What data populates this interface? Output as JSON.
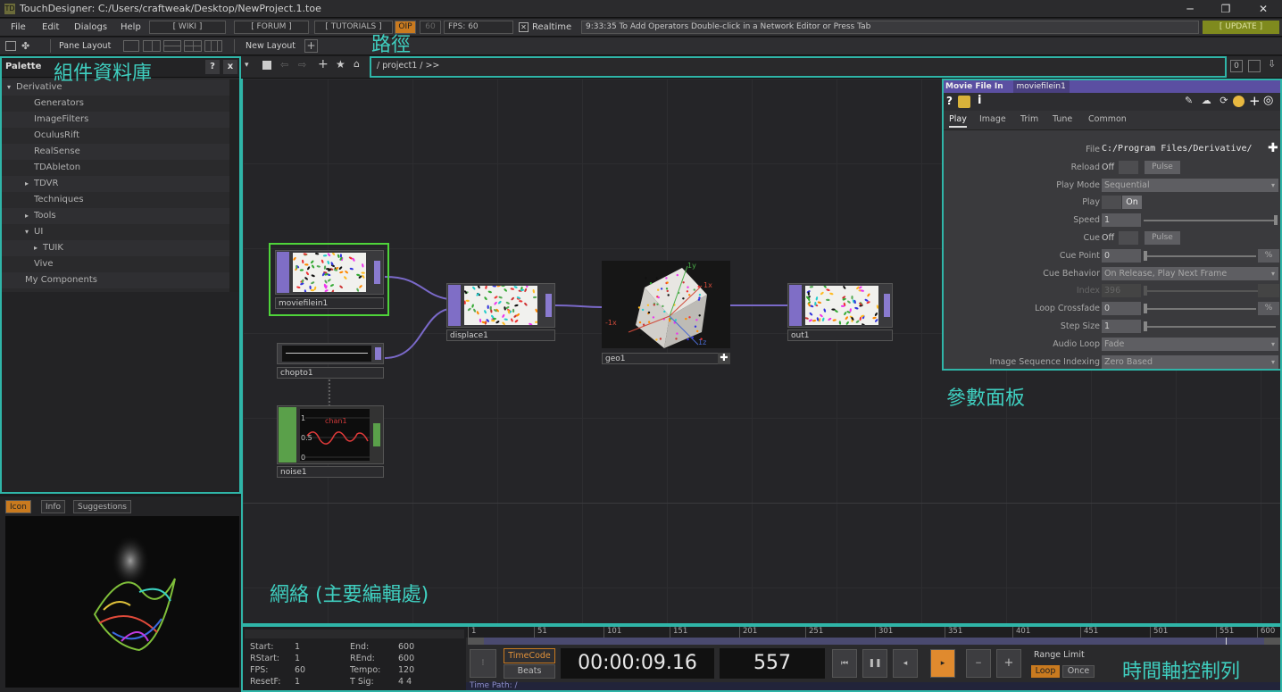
{
  "window": {
    "title": "TouchDesigner: C:/Users/craftweak/Desktop/NewProject.1.toe"
  },
  "menu": {
    "items": [
      "File",
      "Edit",
      "Dialogs",
      "Help"
    ],
    "wiki": "[ WIKI ]",
    "forum": "[ FORUM ]",
    "tutorials": "[ TUTORIALS ]",
    "oip": "OIP",
    "fps_cap": "60",
    "fps": "FPS:  60",
    "realtime": "Realtime",
    "status": "9:33:35 To Add Operators Double-click in a Network Editor or Press Tab",
    "update": "[ UPDATE ]"
  },
  "toolbar": {
    "pane_layout": "Pane Layout",
    "new_layout": "New Layout"
  },
  "palette": {
    "title": "Palette",
    "help": "?",
    "close": "x",
    "items": [
      {
        "label": "Derivative",
        "indent": 0,
        "arrow": "down"
      },
      {
        "label": "Generators",
        "indent": 2,
        "arrow": ""
      },
      {
        "label": "ImageFilters",
        "indent": 2,
        "arrow": ""
      },
      {
        "label": "OculusRift",
        "indent": 2,
        "arrow": ""
      },
      {
        "label": "RealSense",
        "indent": 2,
        "arrow": ""
      },
      {
        "label": "TDAbleton",
        "indent": 2,
        "arrow": ""
      },
      {
        "label": "TDVR",
        "indent": 2,
        "arrow": "right"
      },
      {
        "label": "Techniques",
        "indent": 2,
        "arrow": ""
      },
      {
        "label": "Tools",
        "indent": 2,
        "arrow": "right"
      },
      {
        "label": "UI",
        "indent": 2,
        "arrow": "down"
      },
      {
        "label": "TUIK",
        "indent": 3,
        "arrow": "right"
      },
      {
        "label": "Vive",
        "indent": 2,
        "arrow": ""
      },
      {
        "label": "My Components",
        "indent": 1,
        "arrow": ""
      }
    ]
  },
  "icon_tabs": [
    "Icon",
    "Info",
    "Suggestions"
  ],
  "network": {
    "path": "/ project1 / >>",
    "nodes": {
      "moviefilein": "moviefilein1",
      "displace": "displace1",
      "geo": "geo1",
      "out": "out1",
      "chopto": "chopto1",
      "noise": "noise1",
      "noise_chan": "chan1",
      "noise_y1": "1",
      "noise_y05": "0.5",
      "noise_y0": "0",
      "geo_axis_x": "1x",
      "geo_axis_nx": "-1x",
      "geo_axis_y": "1y",
      "geo_axis_z": "1z"
    }
  },
  "params": {
    "op_type": "Movie File In",
    "op_name": "moviefilein1",
    "tabs": [
      "Play",
      "Image",
      "Trim",
      "Tune",
      "Common"
    ],
    "rows": [
      {
        "label": "File",
        "kind": "file",
        "value": "C:/Program Files/Derivative/"
      },
      {
        "label": "Reload",
        "kind": "togglepulse",
        "value": "Off",
        "pulse": "Pulse"
      },
      {
        "label": "Play Mode",
        "kind": "menu",
        "value": "Sequential"
      },
      {
        "label": "Play",
        "kind": "toggleon",
        "value": "On"
      },
      {
        "label": "Speed",
        "kind": "slider",
        "value": "1"
      },
      {
        "label": "Cue",
        "kind": "togglepulse",
        "value": "Off",
        "pulse": "Pulse"
      },
      {
        "label": "Cue Point",
        "kind": "slider",
        "value": "0",
        "unit": "%"
      },
      {
        "label": "Cue Behavior",
        "kind": "menu",
        "value": "On Release, Play Next Frame"
      },
      {
        "label": "Index",
        "kind": "disabled",
        "value": "396"
      },
      {
        "label": "Loop Crossfade",
        "kind": "slider",
        "value": "0",
        "unit": "%"
      },
      {
        "label": "Step Size",
        "kind": "slider",
        "value": "1"
      },
      {
        "label": "Audio Loop",
        "kind": "menu",
        "value": "Fade"
      },
      {
        "label": "Image Sequence Indexing",
        "kind": "menu",
        "value": "Zero Based"
      }
    ]
  },
  "timeline": {
    "info": [
      [
        "Start:",
        "1",
        "End:",
        "600"
      ],
      [
        "RStart:",
        "1",
        "REnd:",
        "600"
      ],
      [
        "FPS:",
        "60",
        "Tempo:",
        "120"
      ],
      [
        "ResetF:",
        "1",
        "T Sig:",
        "4   4"
      ]
    ],
    "ruler": [
      "1",
      "51",
      "101",
      "151",
      "201",
      "251",
      "301",
      "351",
      "401",
      "451",
      "501",
      "551",
      "600"
    ],
    "timecode_btn": "TimeCode",
    "beats_btn": "Beats",
    "timecode": "00:00:09.16",
    "frame": "557",
    "range_limit": "Range Limit",
    "loop": "Loop",
    "once": "Once",
    "time_path": "Time Path: /"
  },
  "annotations": {
    "palette": "組件資料庫",
    "path": "路徑",
    "params": "參數面板",
    "network": "網絡 (主要編輯處)",
    "timeline": "時間軸控制列"
  },
  "colors": {
    "annotation": "#2fb5a8",
    "top_node": "#7f6ec6",
    "chop_node": "#5aa04a",
    "accent": "#e08a2e"
  }
}
